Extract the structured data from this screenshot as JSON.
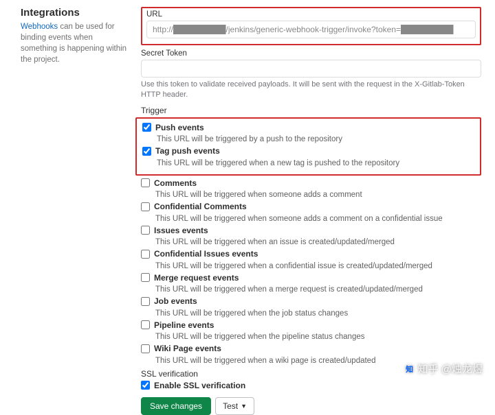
{
  "sidebar": {
    "heading": "Integrations",
    "link_text": "Webhooks",
    "desc_rest": " can be used for binding events when something is happening within the project."
  },
  "url_section": {
    "label": "URL",
    "value": "http://█████████/jenkins/generic-webhook-trigger/invoke?token=█████████"
  },
  "secret_section": {
    "label": "Secret Token",
    "value": "",
    "hint": "Use this token to validate received payloads. It will be sent with the request in the X-Gitlab-Token HTTP header."
  },
  "trigger_label": "Trigger",
  "triggers_boxed": [
    {
      "label": "Push events",
      "desc": "This URL will be triggered by a push to the repository",
      "checked": true
    },
    {
      "label": "Tag push events",
      "desc": "This URL will be triggered when a new tag is pushed to the repository",
      "checked": true
    }
  ],
  "triggers_rest": [
    {
      "label": "Comments",
      "desc": "This URL will be triggered when someone adds a comment",
      "checked": false
    },
    {
      "label": "Confidential Comments",
      "desc": "This URL will be triggered when someone adds a comment on a confidential issue",
      "checked": false
    },
    {
      "label": "Issues events",
      "desc": "This URL will be triggered when an issue is created/updated/merged",
      "checked": false
    },
    {
      "label": "Confidential Issues events",
      "desc": "This URL will be triggered when a confidential issue is created/updated/merged",
      "checked": false
    },
    {
      "label": "Merge request events",
      "desc": "This URL will be triggered when a merge request is created/updated/merged",
      "checked": false
    },
    {
      "label": "Job events",
      "desc": "This URL will be triggered when the job status changes",
      "checked": false
    },
    {
      "label": "Pipeline events",
      "desc": "This URL will be triggered when the pipeline status changes",
      "checked": false
    },
    {
      "label": "Wiki Page events",
      "desc": "This URL will be triggered when a wiki page is created/updated",
      "checked": false
    }
  ],
  "ssl": {
    "heading": "SSL verification",
    "label": "Enable SSL verification",
    "checked": true
  },
  "actions": {
    "save": "Save changes",
    "test": "Test"
  },
  "watermark": "知乎 @烛龙煜"
}
